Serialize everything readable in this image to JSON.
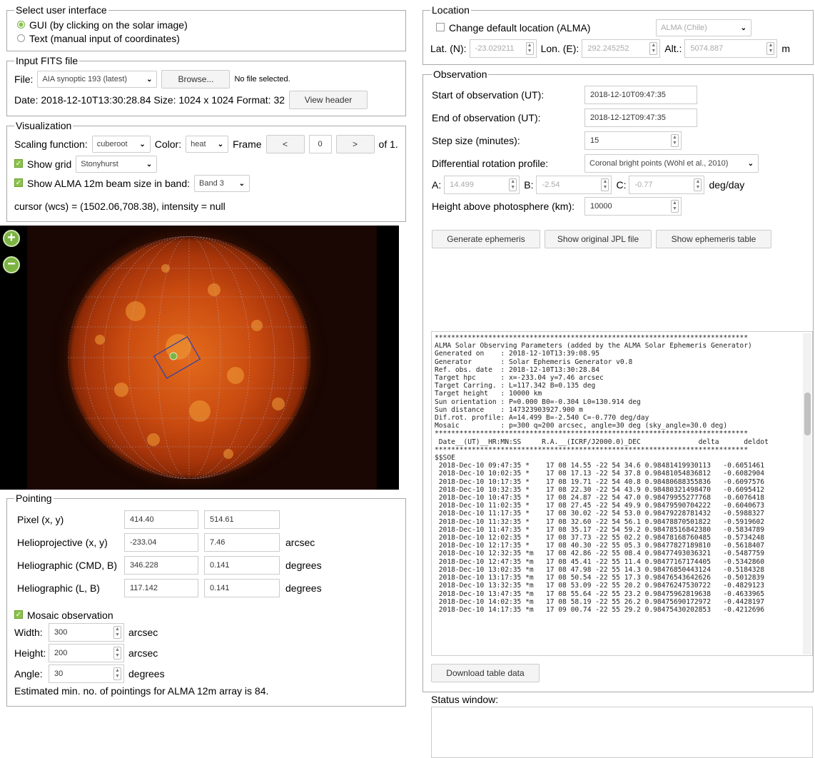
{
  "ui": {
    "legend": "Select user interface",
    "gui_label": "GUI (by clicking on the solar image)",
    "text_label": "Text (manual input of coordinates)"
  },
  "fits": {
    "legend": "Input FITS file",
    "file_label": "File:",
    "file_select": "AIA synoptic 193 (latest)",
    "browse": "Browse...",
    "no_file": "No file selected.",
    "date_line": "Date: 2018-12-10T13:30:28.84 Size: 1024 x 1024 Format: 32",
    "view_header": "View header"
  },
  "vis": {
    "legend": "Visualization",
    "scaling_label": "Scaling function:",
    "scaling_value": "cuberoot",
    "color_label": "Color:",
    "color_value": "heat",
    "frame_label": "Frame",
    "prev": "<",
    "frame_value": "0",
    "next": ">",
    "of": "of 1.",
    "show_grid": "Show grid",
    "grid_value": "Stonyhurst",
    "show_beam": "Show ALMA 12m beam size in band:",
    "band_value": "Band 3",
    "cursor": "cursor (wcs) = (1502.06,708.38), intensity = null"
  },
  "map": {
    "zoom_in": "+",
    "zoom_out": "−"
  },
  "pointing": {
    "legend": "Pointing",
    "rows": [
      {
        "label": "Pixel (x, y)",
        "a": "414.40",
        "b": "514.61",
        "unit": ""
      },
      {
        "label": "Helioprojective (x, y)",
        "a": "-233.04",
        "b": "7.46",
        "unit": "arcsec"
      },
      {
        "label": "Heliographic (CMD, B)",
        "a": "346.228",
        "b": "0.141",
        "unit": "degrees"
      },
      {
        "label": "Heliographic (L, B)",
        "a": "117.142",
        "b": "0.141",
        "unit": "degrees"
      }
    ],
    "mosaic_label": "Mosaic observation",
    "width_label": "Width:",
    "width_value": "300",
    "width_unit": "arcsec",
    "height_label": "Height:",
    "height_value": "200",
    "height_unit": "arcsec",
    "angle_label": "Angle:",
    "angle_value": "30",
    "angle_unit": "degrees",
    "estimate": "Estimated min. no. of pointings for ALMA 12m array is 84."
  },
  "location": {
    "legend": "Location",
    "change_label": "Change default location (ALMA)",
    "site_value": "ALMA (Chile)",
    "lat_label": "Lat. (N):",
    "lat_value": "-23.029211",
    "lon_label": "Lon. (E):",
    "lon_value": "292.245252",
    "alt_label": "Alt.:",
    "alt_value": "5074.887",
    "alt_unit": "m"
  },
  "observation": {
    "legend": "Observation",
    "start_label": "Start of observation (UT):",
    "start_value": "2018-12-10T09:47:35",
    "end_label": "End of observation (UT):",
    "end_value": "2018-12-12T09:47:35",
    "step_label": "Step size (minutes):",
    "step_value": "15",
    "diff_label": "Differential rotation profile:",
    "diff_value": "Coronal bright points (Wöhl et al., 2010)",
    "a_label": "A:",
    "a_value": "14.499",
    "b_label": "B:",
    "b_value": "-2.54",
    "c_label": "C:",
    "c_value": "-0.77",
    "deg_unit": "deg/day",
    "height_label": "Height above photosphere (km):",
    "height_value": "10000",
    "gen_btn": "Generate ephemeris",
    "jpl_btn": "Show original JPL file",
    "table_btn": "Show ephemeris table",
    "ephemeris_text": "****************************************************************************\nALMA Solar Observing Parameters (added by the ALMA Solar Ephemeris Generator)\nGenerated on    : 2018-12-10T13:39:08.95\nGenerator       : Solar Ephemeris Generator v0.8\nRef. obs. date  : 2018-12-10T13:30:28.84\nTarget hpc      : x=-233.04 y=7.46 arcsec\nTarget Carring. : L=117.342 B=0.135 deg\nTarget height   : 10000 km\nSun orientation : P=0.000 B0=-0.304 L0=130.914 deg\nSun distance    : 147323903927.900 m\nDif.rot. profile: A=14.499 B=-2.540 C=-0.770 deg/day\nMosaic          : p=300 q=200 arcsec, angle=30 deg (sky_angle=30.0 deg)\n****************************************************************************\n Date__(UT)__HR:MN:SS     R.A.__(ICRF/J2000.0)_DEC              delta      deldot\n****************************************************************************\n$$SOE\n 2018-Dec-10 09:47:35 *    17 08 14.55 -22 54 34.6 0.98481419930113   -0.6051461\n 2018-Dec-10 10:02:35 *    17 08 17.13 -22 54 37.8 0.98481054836812   -0.6082904\n 2018-Dec-10 10:17:35 *    17 08 19.71 -22 54 40.8 0.98480688355836   -0.6097576\n 2018-Dec-10 10:32:35 *    17 08 22.30 -22 54 43.9 0.98480321498470   -0.6095412\n 2018-Dec-10 10:47:35 *    17 08 24.87 -22 54 47.0 0.98479955277768   -0.6076418\n 2018-Dec-10 11:02:35 *    17 08 27.45 -22 54 49.9 0.98479590704222   -0.6040673\n 2018-Dec-10 11:17:35 *    17 08 30.02 -22 54 53.0 0.98479228781432   -0.5988327\n 2018-Dec-10 11:32:35 *    17 08 32.60 -22 54 56.1 0.98478870501822   -0.5919602\n 2018-Dec-10 11:47:35 *    17 08 35.17 -22 54 59.2 0.98478516842380   -0.5834789\n 2018-Dec-10 12:02:35 *    17 08 37.73 -22 55 02.2 0.98478168760485   -0.5734248\n 2018-Dec-10 12:17:35 *    17 08 40.30 -22 55 05.3 0.98477827189810   -0.5618407\n 2018-Dec-10 12:32:35 *m   17 08 42.86 -22 55 08.4 0.98477493036321   -0.5487759\n 2018-Dec-10 12:47:35 *m   17 08 45.41 -22 55 11.4 0.98477167174405   -0.5342860\n 2018-Dec-10 13:02:35 *m   17 08 47.98 -22 55 14.3 0.98476850443124   -0.5184328\n 2018-Dec-10 13:17:35 *m   17 08 50.54 -22 55 17.3 0.98476543642626   -0.5012839\n 2018-Dec-10 13:32:35 *m   17 08 53.09 -22 55 20.2 0.98476247530722   -0.4829123\n 2018-Dec-10 13:47:35 *m   17 08 55.64 -22 55 23.2 0.98475962819638   -0.4633965\n 2018-Dec-10 14:02:35 *m   17 08 58.19 -22 55 26.2 0.98475690172972   -0.4428197\n 2018-Dec-10 14:17:35 *m   17 09 00.74 -22 55 29.2 0.98475430202853   -0.4212696",
    "download_btn": "Download table data",
    "status_label": "Status window:"
  }
}
